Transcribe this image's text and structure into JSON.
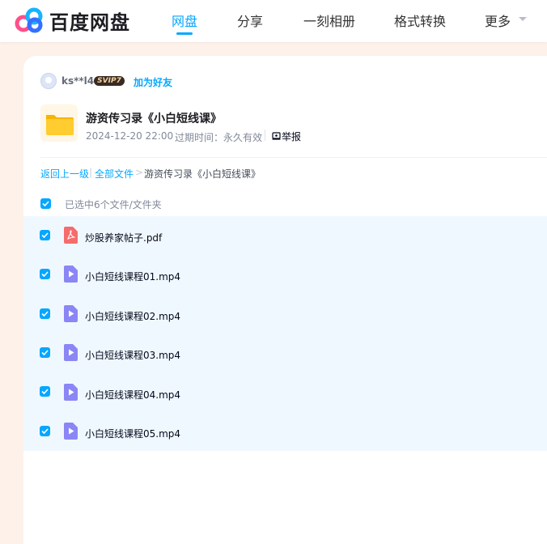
{
  "header": {
    "logo_text": "百度网盘",
    "nav": [
      {
        "label": "网盘",
        "active": true
      },
      {
        "label": "分享",
        "active": false
      },
      {
        "label": "一刻相册",
        "active": false
      },
      {
        "label": "格式转换",
        "active": false
      },
      {
        "label": "更多",
        "active": false
      }
    ]
  },
  "share": {
    "user": {
      "name": "ks**l4",
      "badge": "SVIP7",
      "add_friend": "加为好友"
    },
    "folder": {
      "title": "游资传习录《小白短线课》",
      "date": "2024-12-20 22:00",
      "expire_label": "过期时间：永久有效",
      "report": "举报"
    }
  },
  "breadcrumb": {
    "back": "返回上一级",
    "sep": "|",
    "all": "全部文件",
    "arrow": ">",
    "current": "游资传习录《小白短线课》"
  },
  "selection": {
    "text": "已选中6个文件/文件夹"
  },
  "files": [
    {
      "name": "炒股养家帖子.pdf",
      "type": "pdf-icon"
    },
    {
      "name": "小白短线课程01.mp4",
      "type": "video-icon"
    },
    {
      "name": "小白短线课程02.mp4",
      "type": "video-icon"
    },
    {
      "name": "小白短线课程03.mp4",
      "type": "video-icon"
    },
    {
      "name": "小白短线课程04.mp4",
      "type": "video-icon"
    },
    {
      "name": "小白短线课程05.mp4",
      "type": "video-icon"
    }
  ],
  "colors": {
    "accent": "#06a7ff",
    "page_bg": "#fdf1ea",
    "list_bg": "#f0f8ff",
    "pdf": "#f56c6c",
    "video": "#8a86f5"
  }
}
